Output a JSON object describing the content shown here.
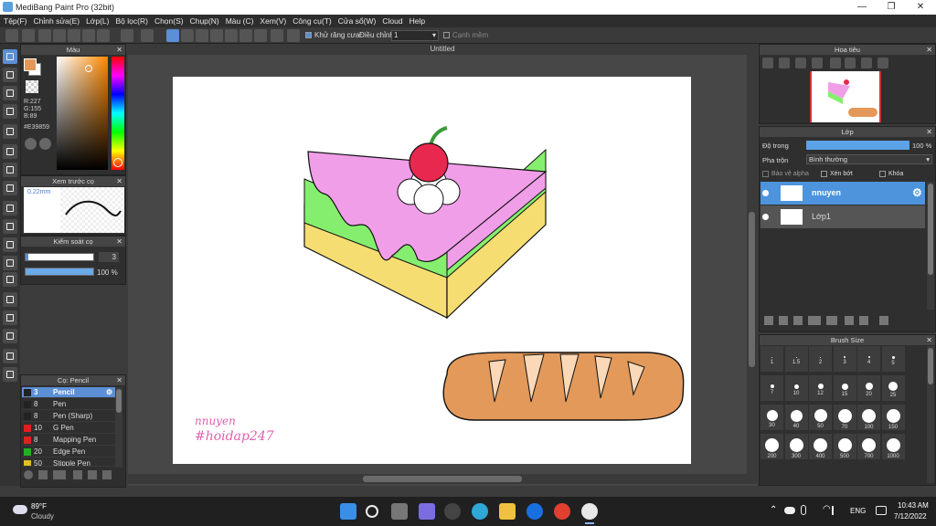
{
  "titlebar": {
    "title": "MediBang Paint Pro (32bit)",
    "minimize": "—",
    "maximize": "❐",
    "close": "✕"
  },
  "menu": [
    "Tệp(F)",
    "Chỉnh sửa(E)",
    "Lớp(L)",
    "Bộ lọc(R)",
    "Chọn(S)",
    "Chụp(N)",
    "Màu (C)",
    "Xem(V)",
    "Công cụ(T)",
    "Cửa sổ(W)",
    "Cloud",
    "Help"
  ],
  "toolbar": {
    "antialias_label": "Khử răng cưa",
    "adjust_label": "Điều chỉnh",
    "adjust_value": "1",
    "edge_label": "Cạnh mềm"
  },
  "color_panel": {
    "title": "Màu",
    "r": "R:227",
    "g": "G:155",
    "b": "B:89",
    "hex": "#E39859",
    "fg_color": "#e39859"
  },
  "brush_preview": {
    "title": "Xem trước cọ",
    "size": "0.22mm"
  },
  "brush_control": {
    "title": "Kiểm soát cọ",
    "size_value": "3",
    "opacity_value": "100 %",
    "opacity_fraction": 1.0
  },
  "brush_list": {
    "title": "Cọ: Pencil",
    "items": [
      {
        "size": "3",
        "name": "Pencil",
        "color": "#222222"
      },
      {
        "size": "8",
        "name": "Pen",
        "color": "#222222"
      },
      {
        "size": "8",
        "name": "Pen (Sharp)",
        "color": "#222222"
      },
      {
        "size": "10",
        "name": "G Pen",
        "color": "#e02020"
      },
      {
        "size": "8",
        "name": "Mapping Pen",
        "color": "#e02020"
      },
      {
        "size": "20",
        "name": "Edge Pen",
        "color": "#20b020"
      },
      {
        "size": "50",
        "name": "Stipple Pen",
        "color": "#e0c020"
      }
    ]
  },
  "canvas": {
    "doc_title": "Untitled",
    "signature_line1": "nnuyen",
    "signature_line2": "#hoidap247"
  },
  "navigator": {
    "title": "Hoa tiêu"
  },
  "layers": {
    "title": "Lớp",
    "opacity_label": "Độ trong",
    "opacity_value": "100 %",
    "blend_label": "Pha trộn",
    "blend_value": "Bình thường",
    "protect_alpha": "Bảo vệ alpha",
    "clip": "Xén bớt",
    "lock": "Khóa",
    "items": [
      {
        "name": "nnuyen"
      },
      {
        "name": "Lớp1"
      }
    ]
  },
  "brush_size": {
    "title": "Brush Size",
    "sizes": [
      "1",
      "1.5",
      "2",
      "3",
      "4",
      "5",
      "7",
      "10",
      "12",
      "15",
      "20",
      "25",
      "30",
      "40",
      "50",
      "70",
      "100",
      "150",
      "200",
      "300",
      "400",
      "500",
      "700",
      "1000"
    ]
  },
  "taskbar": {
    "weather_temp": "89°F",
    "weather_desc": "Cloudy",
    "lang": "ENG",
    "time": "10:43 AM",
    "date": "7/12/2022"
  }
}
